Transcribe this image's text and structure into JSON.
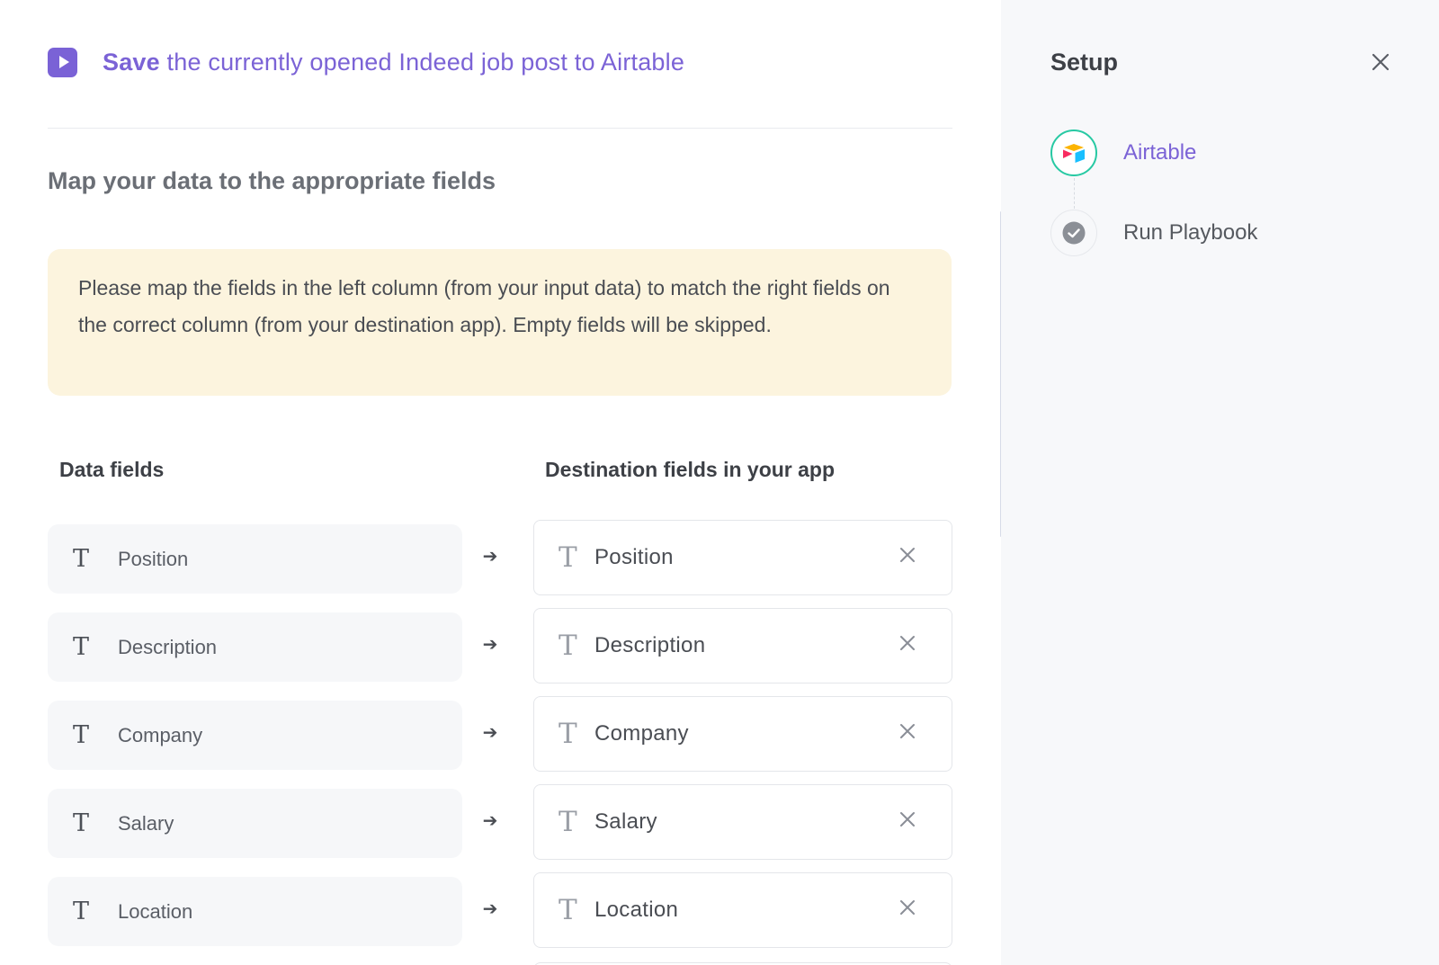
{
  "header": {
    "title_strong": "Save",
    "title_rest": " the currently opened Indeed job post to Airtable",
    "icon": "play-icon",
    "accent_color": "#7b63d6"
  },
  "section_title": "Map your data to the appropriate fields",
  "notice": {
    "text": "Please map the fields in the left column (from your input data) to match the right fields on the correct column (from your destination app). Empty fields will be skipped.",
    "background": "#fcf4de"
  },
  "columns": {
    "left": "Data fields",
    "right": "Destination fields in your app"
  },
  "mappings": [
    {
      "source": "Position",
      "destination": "Position",
      "type_icon": "T"
    },
    {
      "source": "Description",
      "destination": "Description",
      "type_icon": "T"
    },
    {
      "source": "Company",
      "destination": "Company",
      "type_icon": "T"
    },
    {
      "source": "Salary",
      "destination": "Salary",
      "type_icon": "T"
    },
    {
      "source": "Location",
      "destination": "Location",
      "type_icon": "T"
    }
  ],
  "arrow_glyph": "➔",
  "setup": {
    "title": "Setup",
    "steps": [
      {
        "label": "Airtable",
        "icon": "airtable-logo-icon",
        "status": "active"
      },
      {
        "label": "Run Playbook",
        "icon": "check-circle-icon",
        "status": "pending"
      }
    ]
  }
}
